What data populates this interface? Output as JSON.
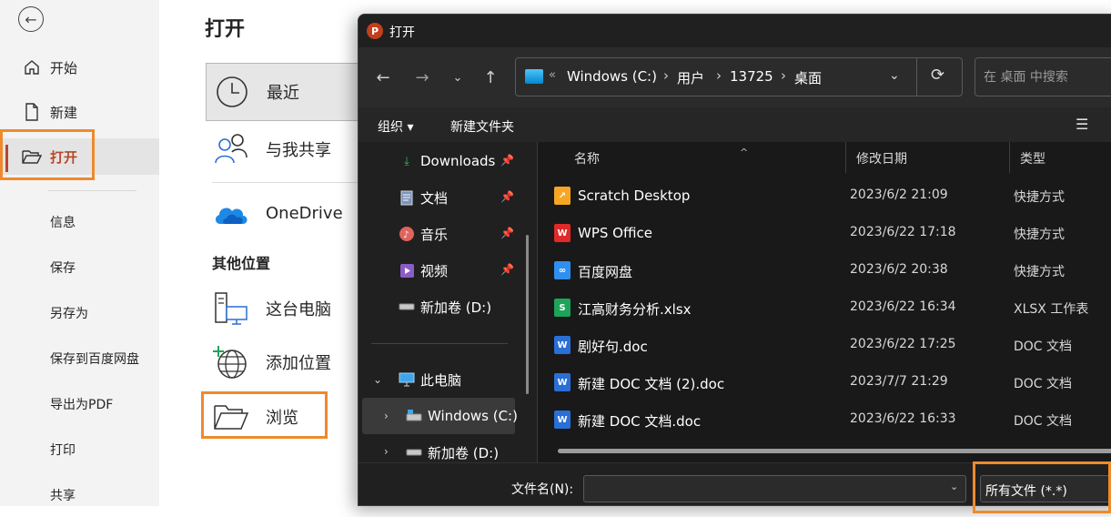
{
  "sidebar": {
    "back_icon": "back-arrow-icon",
    "nav": [
      {
        "label": "开始",
        "icon": "home-icon"
      },
      {
        "label": "新建",
        "icon": "new-document-icon"
      },
      {
        "label": "打开",
        "icon": "open-folder-icon"
      }
    ],
    "sub": [
      "信息",
      "保存",
      "另存为",
      "保存到百度网盘",
      "导出为PDF",
      "打印",
      "共享"
    ]
  },
  "open_panel": {
    "title": "打开",
    "locations": [
      {
        "label": "最近",
        "icon": "clock-icon"
      },
      {
        "label": "与我共享",
        "icon": "people-icon"
      },
      {
        "label": "OneDrive",
        "icon": "onedrive-cloud-icon"
      }
    ],
    "other_title": "其他位置",
    "other_locations": [
      {
        "label": "这台电脑",
        "icon": "this-pc-icon"
      },
      {
        "label": "添加位置",
        "icon": "add-location-globe-icon"
      },
      {
        "label": "浏览",
        "icon": "browse-folder-icon"
      }
    ]
  },
  "dialog": {
    "title": "打开",
    "app_icon_letter": "P",
    "address": {
      "overflow": "«",
      "crumbs": [
        "Windows (C:)",
        "用户",
        "13725",
        "桌面"
      ],
      "sep": "›"
    },
    "search_placeholder": "在 桌面 中搜索",
    "toolbar": {
      "organize": "组织 ▾",
      "new_folder": "新建文件夹"
    },
    "nav_pane": [
      {
        "label": "Downloads",
        "icon": "download-icon",
        "pinned": true
      },
      {
        "label": "文档",
        "icon": "documents-icon",
        "pinned": true
      },
      {
        "label": "音乐",
        "icon": "music-icon",
        "pinned": true
      },
      {
        "label": "视频",
        "icon": "video-icon",
        "pinned": true
      },
      {
        "label": "新加卷 (D:)",
        "icon": "drive-icon",
        "pinned": false
      },
      {
        "label": "此电脑",
        "icon": "this-pc-icon",
        "pinned": false
      },
      {
        "label": "Windows (C:)",
        "icon": "windows-drive-icon",
        "pinned": false
      },
      {
        "label": "新加卷 (D:)",
        "icon": "drive-icon",
        "pinned": false
      }
    ],
    "columns": {
      "name": "名称",
      "date": "修改日期",
      "type": "类型"
    },
    "files": [
      {
        "name": "Scratch Desktop",
        "date": "2023/6/2 21:09",
        "type": "快捷方式",
        "icon": "scratch-shortcut-icon",
        "color": "#f6a623"
      },
      {
        "name": "WPS Office",
        "date": "2023/6/22 17:18",
        "type": "快捷方式",
        "icon": "wps-shortcut-icon",
        "color": "#e02a2a"
      },
      {
        "name": "百度网盘",
        "date": "2023/6/2 20:38",
        "type": "快捷方式",
        "icon": "baidu-netdisk-shortcut-icon",
        "color": "#2f8ff0"
      },
      {
        "name": "江高财务分析.xlsx",
        "date": "2023/6/22 16:34",
        "type": "XLSX 工作表",
        "icon": "xlsx-file-icon",
        "color": "#1ea35a"
      },
      {
        "name": "剧好句.doc",
        "date": "2023/6/22 17:25",
        "type": "DOC 文档",
        "icon": "doc-file-icon",
        "color": "#2a6fd6"
      },
      {
        "name": "新建 DOC 文档 (2).doc",
        "date": "2023/7/7 21:29",
        "type": "DOC 文档",
        "icon": "doc-file-icon",
        "color": "#2a6fd6"
      },
      {
        "name": "新建 DOC 文档.doc",
        "date": "2023/6/22 16:33",
        "type": "DOC 文档",
        "icon": "doc-file-icon",
        "color": "#2a6fd6"
      }
    ],
    "bottom": {
      "filename_label": "文件名(N):",
      "filename_value": "",
      "filetype_value": "所有文件 (*.*)"
    }
  },
  "colors": {
    "accent": "#b7472a",
    "highlight": "#ee8a2c",
    "dialog_bg": "#202020"
  }
}
